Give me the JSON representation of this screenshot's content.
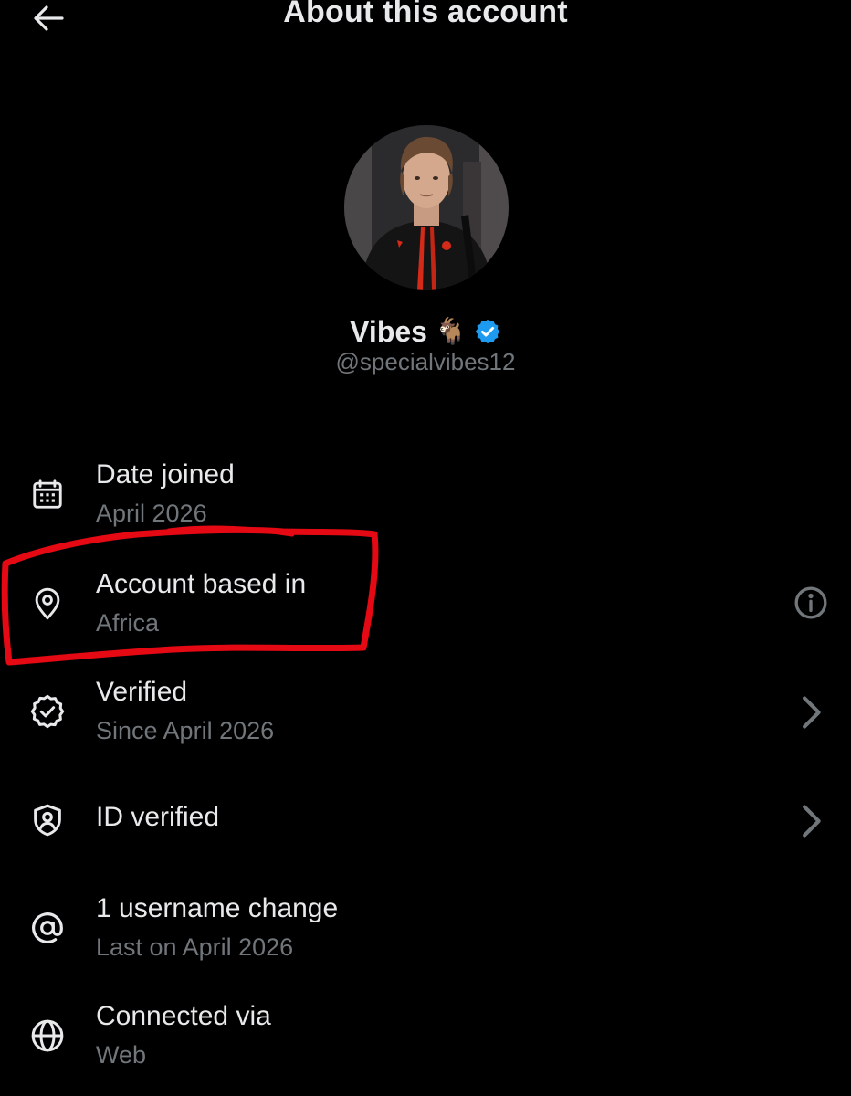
{
  "header": {
    "title": "About this account",
    "back_icon": "arrow-left-icon"
  },
  "profile": {
    "display_name": "Vibes",
    "emoji": "🐐",
    "verified_badge_color": "#1d9bf0",
    "handle": "@specialvibes12"
  },
  "details": [
    {
      "icon": "calendar-icon",
      "title": "Date joined",
      "subtitle": "April 2026"
    },
    {
      "icon": "location-pin-icon",
      "title": "Account based in",
      "subtitle": "Africa",
      "trailing": "info-icon"
    },
    {
      "icon": "verified-badge-icon",
      "title": "Verified",
      "subtitle": "Since April 2026",
      "trailing": "chevron-right-icon"
    },
    {
      "icon": "id-shield-icon",
      "title": "ID verified",
      "trailing": "chevron-right-icon"
    },
    {
      "icon": "at-sign-icon",
      "title": "1 username change",
      "subtitle": "Last on April 2026"
    },
    {
      "icon": "globe-icon",
      "title": "Connected via",
      "subtitle": "Web"
    }
  ],
  "colors": {
    "background": "#000000",
    "primary_text": "#e7e9ea",
    "secondary_text": "#71767b",
    "annotation": "#e50914"
  }
}
